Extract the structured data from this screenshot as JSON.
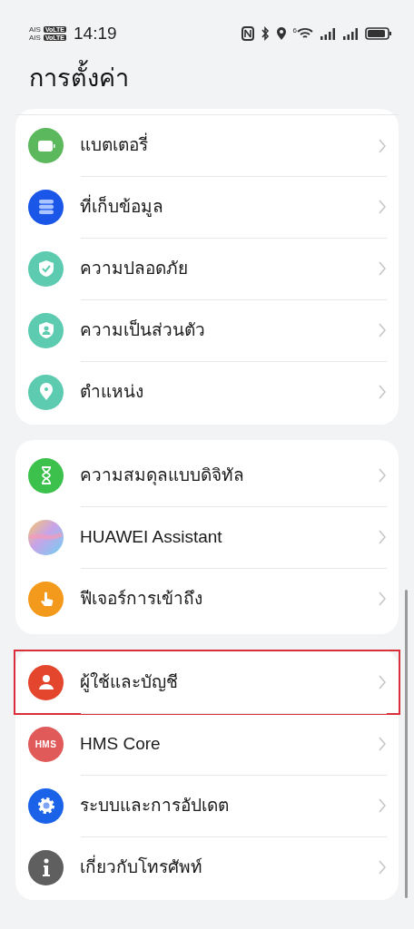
{
  "status_bar": {
    "carriers": [
      {
        "name": "AIS",
        "badge": "VoLTE"
      },
      {
        "name": "AIS",
        "badge": "VoLTE"
      }
    ],
    "time": "14:19",
    "wifi_label": "6"
  },
  "title": "การตั้งค่า",
  "groups": [
    {
      "items": [
        {
          "label": "แบตเตอรี่",
          "kind": "battery",
          "color": "#5cb85c",
          "highlighted": false
        },
        {
          "label": "ที่เก็บข้อมูล",
          "kind": "storage",
          "color": "#1a56e8",
          "highlighted": false
        },
        {
          "label": "ความปลอดภัย",
          "kind": "shield-check",
          "color": "#5dcbb0",
          "highlighted": false
        },
        {
          "label": "ความเป็นส่วนตัว",
          "kind": "shield-person",
          "color": "#5dcbb0",
          "highlighted": false
        },
        {
          "label": "ตำแหน่ง",
          "kind": "location",
          "color": "#5dcbb0",
          "highlighted": false
        }
      ]
    },
    {
      "items": [
        {
          "label": "ความสมดุลแบบดิจิทัล",
          "kind": "hourglass",
          "color": "#3cc14d",
          "highlighted": false
        },
        {
          "label": "HUAWEI Assistant",
          "kind": "orb",
          "highlighted": false
        },
        {
          "label": "ฟีเจอร์การเข้าถึง",
          "kind": "hand",
          "color": "#f39a1c",
          "highlighted": false
        }
      ]
    },
    {
      "items": [
        {
          "label": "ผู้ใช้และบัญชี",
          "kind": "person",
          "color": "#e3462d",
          "highlighted": true
        },
        {
          "label": "HMS Core",
          "kind": "text",
          "text": "HMS",
          "color": "#e05a5a",
          "highlighted": false
        },
        {
          "label": "ระบบและการอัปเดต",
          "kind": "gear",
          "color": "#1a63e8",
          "highlighted": false
        },
        {
          "label": "เกี่ยวกับโทรศัพท์",
          "kind": "info",
          "color": "#5f5f5f",
          "highlighted": false
        }
      ]
    }
  ]
}
